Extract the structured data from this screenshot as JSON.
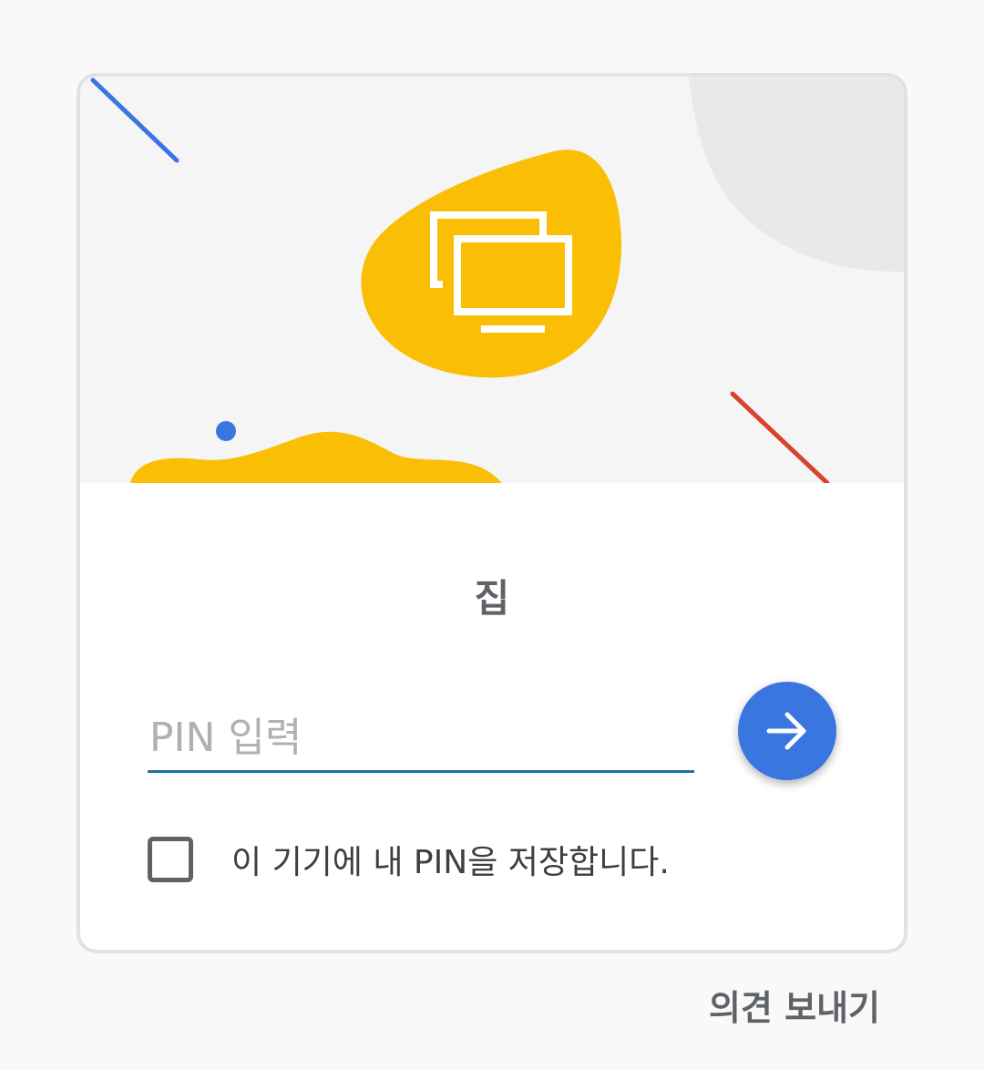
{
  "host": {
    "name": "집"
  },
  "pin": {
    "placeholder": "PIN 입력",
    "value": ""
  },
  "remember": {
    "label": "이 기기에 내 PIN을 저장합니다.",
    "checked": false
  },
  "submit": {
    "icon": "arrow-forward-icon"
  },
  "hero": {
    "icon": "remote-desktop-icon"
  },
  "footer": {
    "feedback_label": "의견 보내기"
  },
  "colors": {
    "accent_blue": "#3a76e0",
    "accent_yellow": "#fabf05",
    "accent_red": "#d9422f",
    "input_underline": "#1f72a8"
  }
}
